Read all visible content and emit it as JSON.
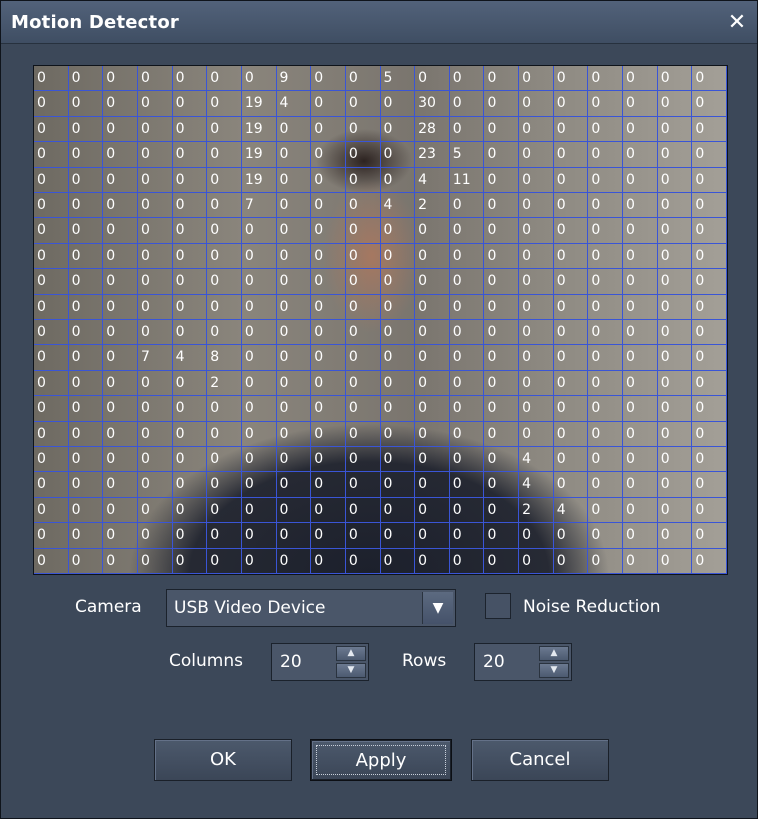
{
  "window": {
    "title": "Motion Detector",
    "close_label": "✕"
  },
  "grid": {
    "columns": 20,
    "rows": 20,
    "cells": [
      [
        0,
        0,
        0,
        0,
        0,
        0,
        0,
        9,
        0,
        0,
        5,
        0,
        0,
        0,
        0,
        0,
        0,
        0,
        0,
        0
      ],
      [
        0,
        0,
        0,
        0,
        0,
        0,
        19,
        4,
        0,
        0,
        0,
        30,
        0,
        0,
        0,
        0,
        0,
        0,
        0,
        0
      ],
      [
        0,
        0,
        0,
        0,
        0,
        0,
        19,
        0,
        0,
        0,
        0,
        28,
        0,
        0,
        0,
        0,
        0,
        0,
        0,
        0
      ],
      [
        0,
        0,
        0,
        0,
        0,
        0,
        19,
        0,
        0,
        0,
        0,
        23,
        5,
        0,
        0,
        0,
        0,
        0,
        0,
        0
      ],
      [
        0,
        0,
        0,
        0,
        0,
        0,
        19,
        0,
        0,
        0,
        0,
        4,
        11,
        0,
        0,
        0,
        0,
        0,
        0,
        0
      ],
      [
        0,
        0,
        0,
        0,
        0,
        0,
        7,
        0,
        0,
        0,
        4,
        2,
        0,
        0,
        0,
        0,
        0,
        0,
        0,
        0
      ],
      [
        0,
        0,
        0,
        0,
        0,
        0,
        0,
        0,
        0,
        0,
        0,
        0,
        0,
        0,
        0,
        0,
        0,
        0,
        0,
        0
      ],
      [
        0,
        0,
        0,
        0,
        0,
        0,
        0,
        0,
        0,
        0,
        0,
        0,
        0,
        0,
        0,
        0,
        0,
        0,
        0,
        0
      ],
      [
        0,
        0,
        0,
        0,
        0,
        0,
        0,
        0,
        0,
        0,
        0,
        0,
        0,
        0,
        0,
        0,
        0,
        0,
        0,
        0
      ],
      [
        0,
        0,
        0,
        0,
        0,
        0,
        0,
        0,
        0,
        0,
        0,
        0,
        0,
        0,
        0,
        0,
        0,
        0,
        0,
        0
      ],
      [
        0,
        0,
        0,
        0,
        0,
        0,
        0,
        0,
        0,
        0,
        0,
        0,
        0,
        0,
        0,
        0,
        0,
        0,
        0,
        0
      ],
      [
        0,
        0,
        0,
        7,
        4,
        8,
        0,
        0,
        0,
        0,
        0,
        0,
        0,
        0,
        0,
        0,
        0,
        0,
        0,
        0
      ],
      [
        0,
        0,
        0,
        0,
        0,
        2,
        0,
        0,
        0,
        0,
        0,
        0,
        0,
        0,
        0,
        0,
        0,
        0,
        0,
        0
      ],
      [
        0,
        0,
        0,
        0,
        0,
        0,
        0,
        0,
        0,
        0,
        0,
        0,
        0,
        0,
        0,
        0,
        0,
        0,
        0,
        0
      ],
      [
        0,
        0,
        0,
        0,
        0,
        0,
        0,
        0,
        0,
        0,
        0,
        0,
        0,
        0,
        0,
        0,
        0,
        0,
        0,
        0
      ],
      [
        0,
        0,
        0,
        0,
        0,
        0,
        0,
        0,
        0,
        0,
        0,
        0,
        0,
        0,
        4,
        0,
        0,
        0,
        0,
        0
      ],
      [
        0,
        0,
        0,
        0,
        0,
        0,
        0,
        0,
        0,
        0,
        0,
        0,
        0,
        0,
        4,
        0,
        0,
        0,
        0,
        0
      ],
      [
        0,
        0,
        0,
        0,
        0,
        0,
        0,
        0,
        0,
        0,
        0,
        0,
        0,
        0,
        2,
        4,
        0,
        0,
        0,
        0
      ],
      [
        0,
        0,
        0,
        0,
        0,
        0,
        0,
        0,
        0,
        0,
        0,
        0,
        0,
        0,
        0,
        0,
        0,
        0,
        0,
        0
      ],
      [
        0,
        0,
        0,
        0,
        0,
        0,
        0,
        0,
        0,
        0,
        0,
        0,
        0,
        0,
        0,
        0,
        0,
        0,
        0,
        0
      ]
    ],
    "line_color": "#3a55d6"
  },
  "camera": {
    "label": "Camera",
    "value": "USB Video Device",
    "dropdown_icon": "chevron-down-icon"
  },
  "noise_reduction": {
    "label": "Noise Reduction",
    "checked": false
  },
  "columns": {
    "label": "Columns",
    "value": "20"
  },
  "rows": {
    "label": "Rows",
    "value": "20"
  },
  "buttons": {
    "ok": "OK",
    "apply": "Apply",
    "cancel": "Cancel"
  },
  "colors": {
    "window_bg": "#3c4859",
    "title_bg": "#4a5a70",
    "text": "#ffffff"
  }
}
